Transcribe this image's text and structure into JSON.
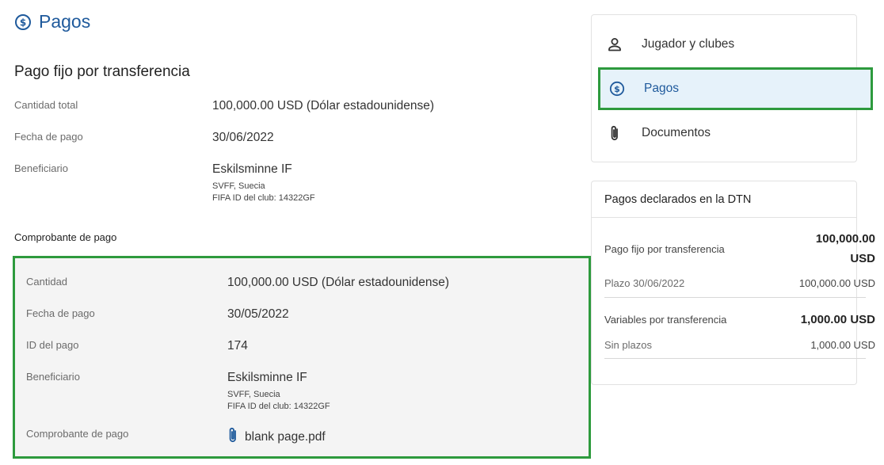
{
  "header": {
    "title": "Pagos",
    "icon": "dollar-circle-icon",
    "color": "#1f5a9c"
  },
  "fixed_payment": {
    "title": "Pago fijo por transferencia",
    "total_label": "Cantidad total",
    "total_value": "100,000.00 USD (Dólar estadounidense)",
    "date_label": "Fecha de pago",
    "date_value": "30/06/2022",
    "beneficiary_label": "Beneficiario",
    "beneficiary_name": "Eskilsminne IF",
    "beneficiary_assoc": "SVFF, Suecia",
    "beneficiary_fifa_id": "FIFA ID del club: 14322GF"
  },
  "receipt": {
    "section_label": "Comprobante de pago",
    "amount_label": "Cantidad",
    "amount_value": "100,000.00 USD (Dólar estadounidense)",
    "date_label": "Fecha de pago",
    "date_value": "30/05/2022",
    "payment_id_label": "ID del pago",
    "payment_id_value": "174",
    "beneficiary_label": "Beneficiario",
    "beneficiary_name": "Eskilsminne IF",
    "beneficiary_assoc": "SVFF, Suecia",
    "beneficiary_fifa_id": "FIFA ID del club: 14322GF",
    "proof_label": "Comprobante de pago",
    "proof_file": "blank page.pdf",
    "highlight_color": "#2d9a3d"
  },
  "side_nav": {
    "items": [
      {
        "label": "Jugador y clubes",
        "icon": "person-icon",
        "active": false
      },
      {
        "label": "Pagos",
        "icon": "dollar-circle-icon",
        "active": true
      },
      {
        "label": "Documentos",
        "icon": "paperclip-icon",
        "active": false
      }
    ],
    "active_bg": "#e6f2fa"
  },
  "summary": {
    "title": "Pagos declarados en la DTN",
    "fixed_label": "Pago fijo por transferencia",
    "fixed_value_line1": "100,000.00",
    "fixed_value_line2": "USD",
    "fixed_term_label": "Plazo 30/06/2022",
    "fixed_term_value": "100,000.00 USD",
    "variable_label": "Variables por transferencia",
    "variable_value": "1,000.00 USD",
    "variable_term_label": "Sin plazos",
    "variable_term_value": "1,000.00 USD"
  }
}
